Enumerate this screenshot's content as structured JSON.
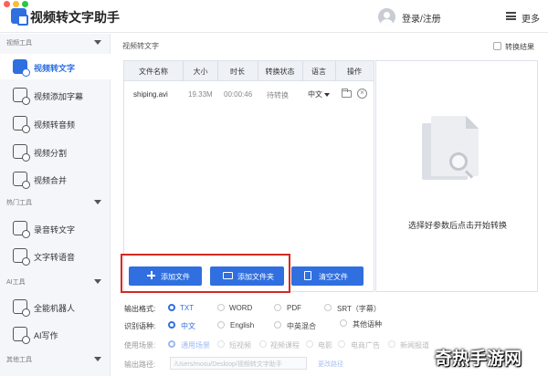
{
  "window": {
    "app_title": "视频转文字助手",
    "login_label": "登录/注册",
    "more_label": "更多",
    "traffic_colors": [
      "#ff5f57",
      "#febc2e",
      "#28c840"
    ]
  },
  "sidebar": {
    "sections": [
      {
        "title": "视频工具",
        "items": [
          {
            "label": "视频转文字",
            "icon": "video-text-icon",
            "active": true
          },
          {
            "label": "视频添加字幕",
            "icon": "subtitle-icon"
          },
          {
            "label": "视频转音频",
            "icon": "video-audio-icon"
          },
          {
            "label": "视频分割",
            "icon": "split-icon"
          },
          {
            "label": "视频合并",
            "icon": "merge-icon"
          }
        ]
      },
      {
        "title": "热门工具",
        "items": [
          {
            "label": "录音转文字",
            "icon": "mic-icon"
          },
          {
            "label": "文字转语音",
            "icon": "text-speech-icon"
          }
        ]
      },
      {
        "title": "AI工具",
        "items": [
          {
            "label": "全能机器人",
            "icon": "robot-icon"
          },
          {
            "label": "AI写作",
            "icon": "ai-write-icon"
          }
        ]
      },
      {
        "title": "其他工具",
        "items": []
      }
    ]
  },
  "main": {
    "title": "视频转文字",
    "convert_result_label": "转换结果",
    "table": {
      "headers": [
        "文件名称",
        "大小",
        "时长",
        "转换状态",
        "语言",
        "操作"
      ],
      "rows": [
        {
          "name": "shiping.avi",
          "size": "19.33M",
          "duration": "00:00:46",
          "status": "待转换",
          "language": "中文"
        }
      ]
    },
    "preview_hint": "选择好参数后点击开始转换",
    "buttons": {
      "add_file": "添加文件",
      "add_folder": "添加文件夹",
      "clear_files": "清空文件"
    },
    "output_format": {
      "label": "输出格式:",
      "options": [
        "TXT",
        "WORD",
        "PDF",
        "SRT（字幕）"
      ],
      "selected": "TXT"
    },
    "recognition_language": {
      "label": "识别语种:",
      "options": [
        "中文",
        "English",
        "中英混合",
        "其他语种"
      ],
      "selected": "中文"
    },
    "scene": {
      "label": "使用场景:",
      "options": [
        "通用场景",
        "短视频",
        "视频课程",
        "电影",
        "电商广告",
        "新闻报道"
      ],
      "selected": "通用场景"
    },
    "output_path": {
      "label": "输出路径:",
      "value": "/Users/mosu/Desktop/视频转文字助手",
      "change_label": "更改路径"
    }
  },
  "watermark": "奇热手游网",
  "colors": {
    "accent": "#2f6fe0",
    "highlight_frame": "#d42a22"
  }
}
